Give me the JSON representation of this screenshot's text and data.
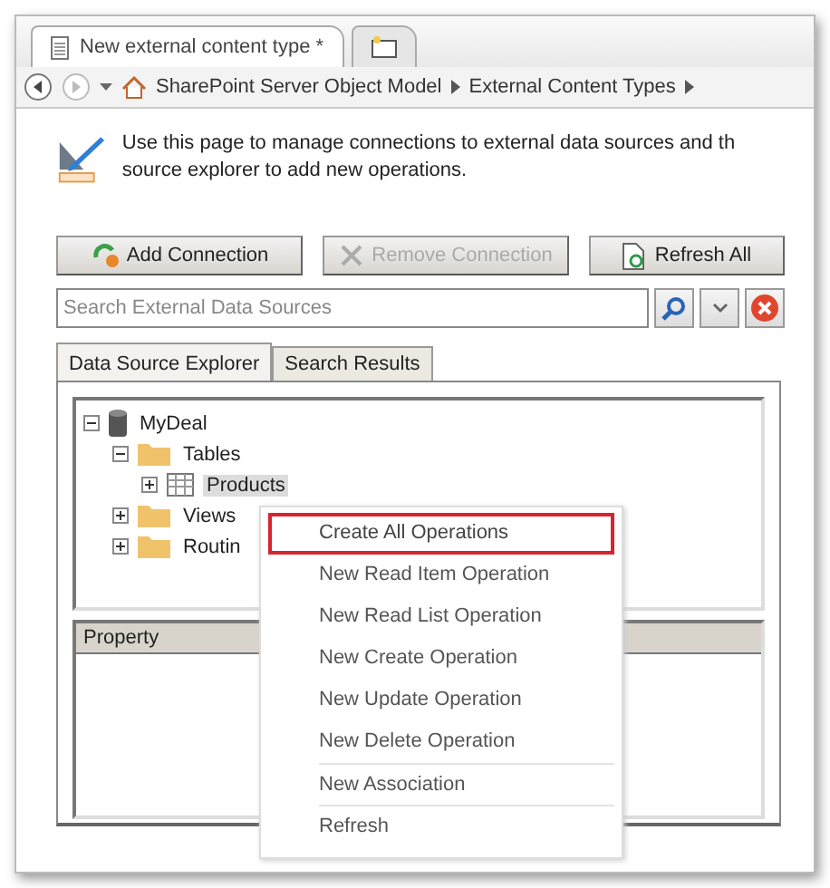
{
  "document_tabs": [
    {
      "label": "New external content type *",
      "kind": "document",
      "selected": true
    },
    {
      "kind": "new",
      "selected": false
    }
  ],
  "breadcrumb": [
    "SharePoint Server Object Model",
    "External Content Types"
  ],
  "intro": "Use this page to manage connections to external data sources and th source explorer to add new operations.",
  "buttons": [
    {
      "label": "Add Connection",
      "kind": "add",
      "disabled": false
    },
    {
      "label": "Remove Connection",
      "kind": "remove",
      "disabled": true
    },
    {
      "label": "Refresh All",
      "kind": "refresh",
      "disabled": false
    }
  ],
  "search": {
    "placeholder": "Search External Data Sources"
  },
  "panel_tabs": [
    {
      "label": "Data Source Explorer",
      "selected": true
    },
    {
      "label": "Search Results",
      "selected": false
    }
  ],
  "tree": [
    {
      "label": "MyDeal",
      "kind": "database",
      "expanded": true,
      "selected": false,
      "children": [
        {
          "label": "Tables",
          "kind": "folder",
          "expanded": true,
          "selected": false,
          "children": [
            {
              "label": "Products",
              "kind": "table",
              "expanded": false,
              "selected": true
            }
          ]
        },
        {
          "label": "Views",
          "kind": "folder",
          "expanded": false,
          "selected": false
        },
        {
          "label": "Routin",
          "kind": "folder",
          "expanded": false,
          "selected": false
        }
      ]
    }
  ],
  "property_header": "Property",
  "context_menu": [
    {
      "label": "Create All Operations",
      "selected": true,
      "separator_before": false
    },
    {
      "label": "New Read Item Operation",
      "selected": false,
      "separator_before": false
    },
    {
      "label": "New Read List Operation",
      "selected": false,
      "separator_before": false
    },
    {
      "label": "New Create Operation",
      "selected": false,
      "separator_before": false
    },
    {
      "label": "New Update Operation",
      "selected": false,
      "separator_before": false
    },
    {
      "label": "New Delete Operation",
      "selected": false,
      "separator_before": false
    },
    {
      "label": "New Association",
      "selected": false,
      "separator_before": true
    },
    {
      "label": "Refresh",
      "selected": false,
      "separator_before": true
    }
  ]
}
